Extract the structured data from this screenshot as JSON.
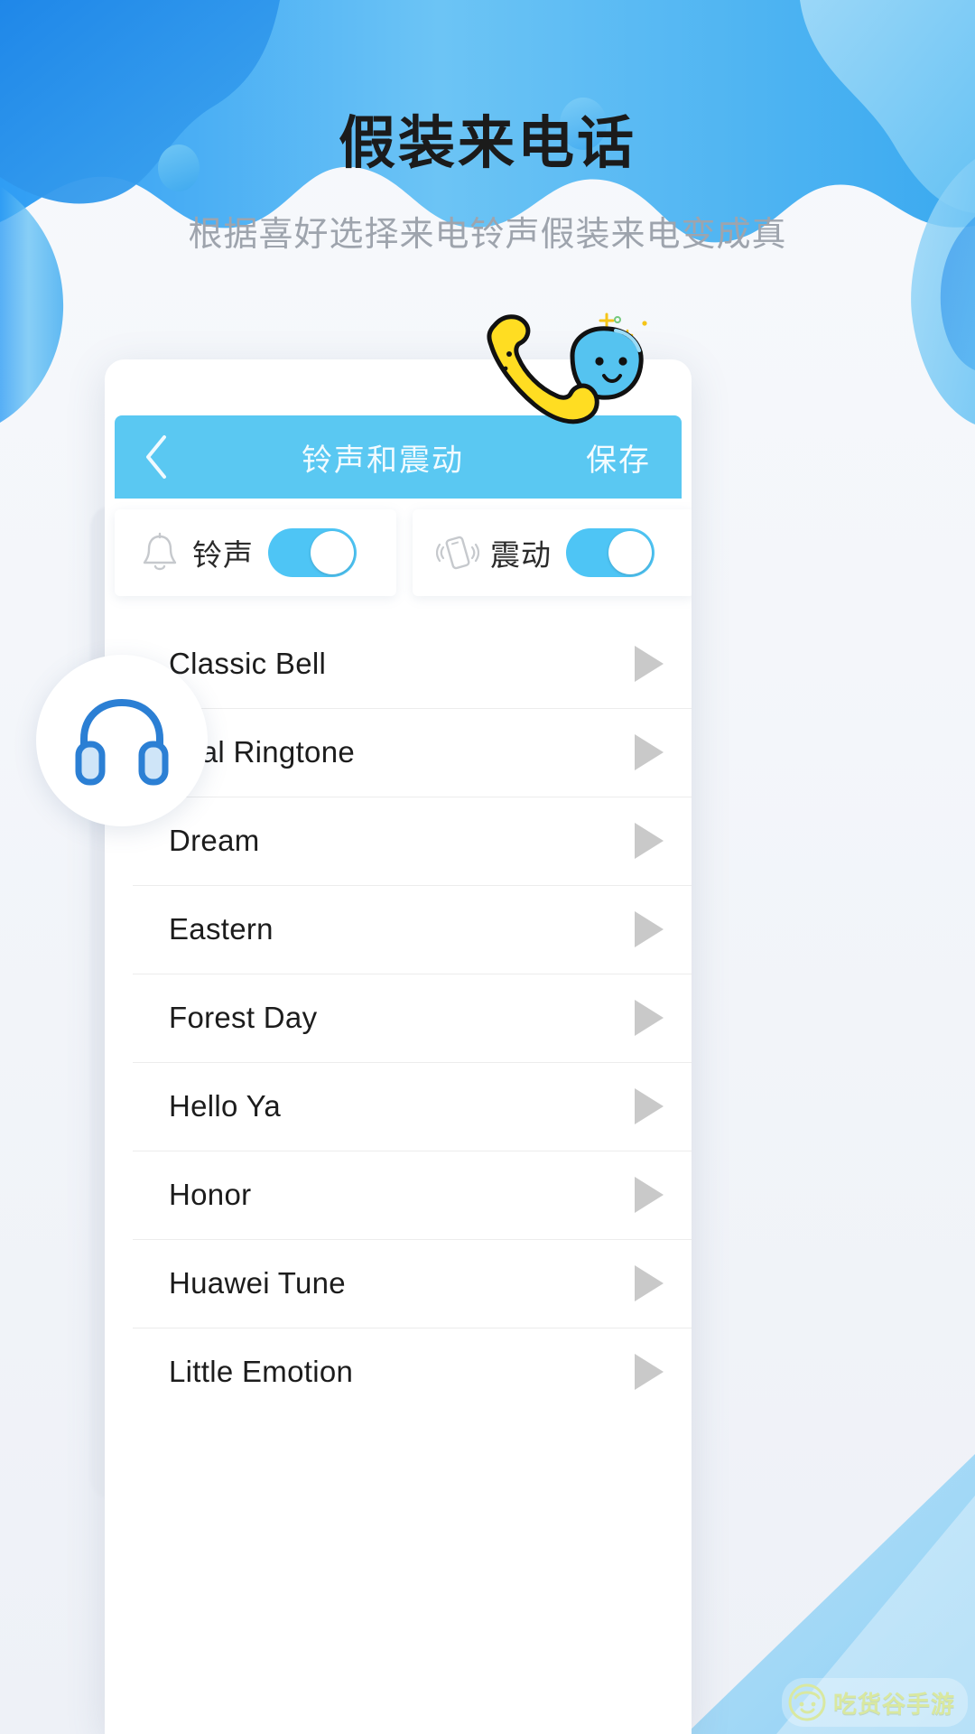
{
  "hero": {
    "title": "假装来电话",
    "subtitle": "根据喜好选择来电铃声假装来电变成真"
  },
  "phone": {
    "header": {
      "back_icon": "chevron-left-icon",
      "title": "铃声和震动",
      "save_label": "保存"
    },
    "toggles": [
      {
        "icon": "bell-icon",
        "label": "铃声",
        "state": "on"
      },
      {
        "icon": "vibrate-icon",
        "label": "震动",
        "state": "on"
      }
    ],
    "ringtones": [
      {
        "name": "Classic Bell",
        "action_icon": "play-icon"
      },
      {
        "name": "gital Ringtone",
        "action_icon": "play-icon"
      },
      {
        "name": "Dream",
        "action_icon": "play-icon"
      },
      {
        "name": "Eastern",
        "action_icon": "play-icon"
      },
      {
        "name": "Forest Day",
        "action_icon": "play-icon"
      },
      {
        "name": "Hello Ya",
        "action_icon": "play-icon"
      },
      {
        "name": "Honor",
        "action_icon": "play-icon"
      },
      {
        "name": "Huawei Tune",
        "action_icon": "play-icon"
      },
      {
        "name": "Little Emotion",
        "action_icon": "play-icon"
      }
    ]
  },
  "badges": {
    "headphone_icon": "headphone-icon",
    "mascot_icon": "phone-handset-mascot-icon"
  },
  "watermark": {
    "text": "吃货谷手游",
    "icon": "smiley-face-icon"
  },
  "colors": {
    "accent": "#5ac8f2",
    "switch_on": "#4ec5f5",
    "page_bg": "#f4f6fa",
    "title": "#1b1b1b",
    "subtitle": "#9ea4ad",
    "play_icon": "#c9c9c9",
    "watermark_text": "#d9e8a0"
  }
}
